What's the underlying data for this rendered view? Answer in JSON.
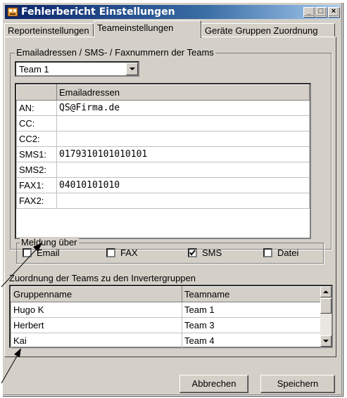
{
  "window": {
    "title": "Fehlerbericht Einstellungen"
  },
  "tabs": [
    "Reporteinstellungen",
    "Teameinstellungen",
    "Geräte Gruppen Zuordnung"
  ],
  "emails_group": {
    "legend": "Emailadressen / SMS- / Faxnummern der Teams",
    "team_select": "Team 1",
    "column_header": "Emailadressen",
    "rows": [
      {
        "label": "AN:",
        "value": "QS@Firma.de"
      },
      {
        "label": "CC:",
        "value": ""
      },
      {
        "label": "CC2:",
        "value": ""
      },
      {
        "label": "SMS1:",
        "value": "0179310101010101"
      },
      {
        "label": "SMS2:",
        "value": ""
      },
      {
        "label": "FAX1:",
        "value": "04010101010"
      },
      {
        "label": "FAX2:",
        "value": ""
      }
    ]
  },
  "notify_group": {
    "legend": "Meldung über",
    "options": [
      {
        "label": "Email",
        "checked": false
      },
      {
        "label": "FAX",
        "checked": false
      },
      {
        "label": "SMS",
        "checked": true
      },
      {
        "label": "Datei",
        "checked": false
      }
    ]
  },
  "assignment": {
    "caption": "Zuordnung der Teams zu den Invertergruppen",
    "headers": [
      "Gruppenname",
      "Teamname"
    ],
    "rows": [
      [
        "Hugo K",
        "Team 1"
      ],
      [
        "Herbert",
        "Team 3"
      ],
      [
        "Kai",
        "Team 4"
      ]
    ]
  },
  "buttons": {
    "cancel": "Abbrechen",
    "save": "Speichern"
  }
}
